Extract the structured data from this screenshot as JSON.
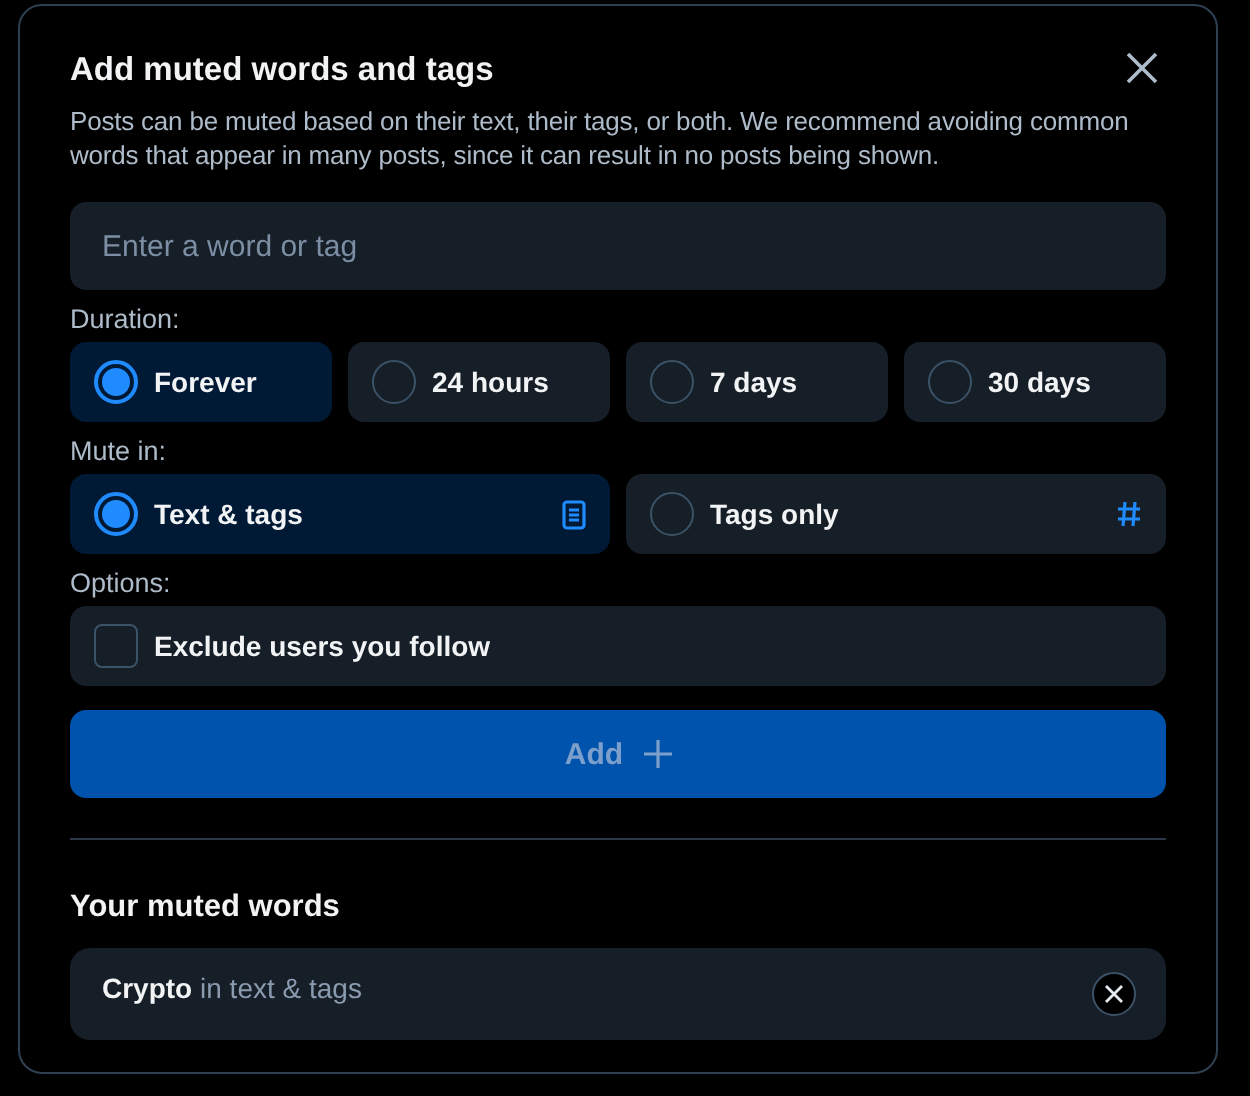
{
  "dialog": {
    "title": "Add muted words and tags",
    "description": "Posts can be muted based on their text, their tags, or both. We recommend avoiding common words that appear in many posts, since it can result in no posts being shown.",
    "input": {
      "placeholder": "Enter a word or tag"
    },
    "duration": {
      "label": "Duration:",
      "options": [
        {
          "label": "Forever",
          "selected": true
        },
        {
          "label": "24 hours",
          "selected": false
        },
        {
          "label": "7 days",
          "selected": false
        },
        {
          "label": "30 days",
          "selected": false
        }
      ]
    },
    "mute_in": {
      "label": "Mute in:",
      "options": [
        {
          "label": "Text & tags",
          "selected": true,
          "kind": "document"
        },
        {
          "label": "Tags only",
          "selected": false,
          "kind": "hash"
        }
      ]
    },
    "options": {
      "label": "Options:",
      "items": [
        {
          "label": "Exclude users you follow",
          "checked": false
        }
      ]
    },
    "add_button": {
      "label": "Add",
      "disabled": true
    },
    "muted_words": {
      "heading": "Your muted words",
      "items": [
        {
          "text": "**Crypto** in text & tags"
        }
      ]
    }
  }
}
